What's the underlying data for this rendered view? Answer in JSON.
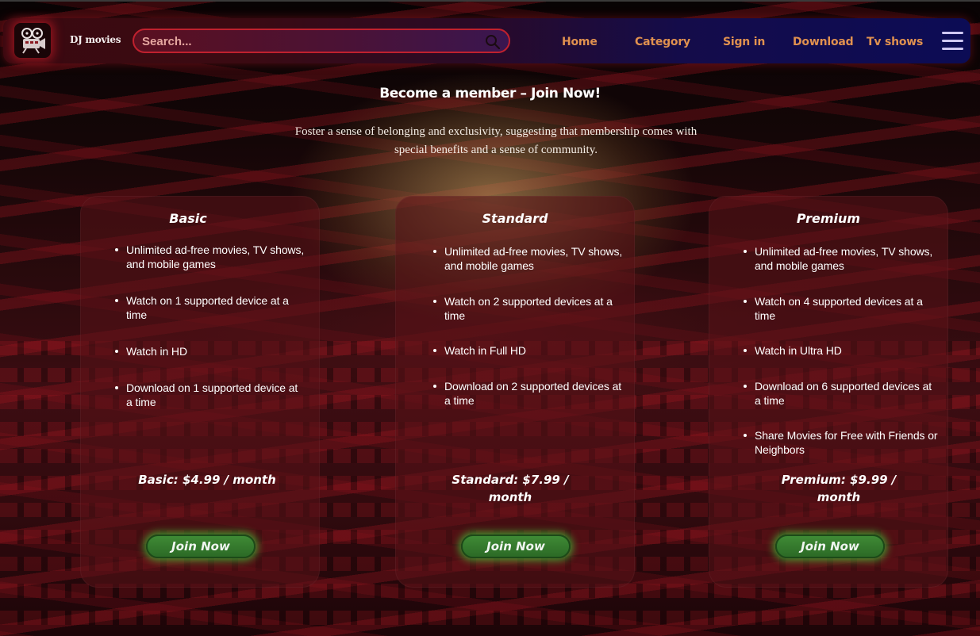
{
  "brand": {
    "name": "DJ movies",
    "logo_icon": "film-camera-icon"
  },
  "search": {
    "placeholder": "Search...",
    "icon": "search-icon"
  },
  "nav": {
    "links": [
      {
        "label": "Home"
      },
      {
        "label": "Category"
      },
      {
        "label": "Sign in"
      },
      {
        "label": "Download"
      },
      {
        "label": "Tv shows"
      }
    ],
    "menu_icon": "hamburger-menu-icon"
  },
  "hero": {
    "title": "Become a member – Join Now!",
    "subtitle": "Foster a sense of belonging and exclusivity, suggesting that membership comes with special benefits and a sense of community."
  },
  "plans": [
    {
      "name": "Basic",
      "features": [
        "Unlimited ad-free movies, TV shows, and mobile games",
        "Watch on 1 supported device at a time",
        "Watch in HD",
        "Download on 1 supported device at a time"
      ],
      "price": "Basic: $4.99 / month",
      "button": "Join Now"
    },
    {
      "name": "Standard",
      "features": [
        " Unlimited ad-free movies, TV shows, and mobile games",
        "Watch on 2 supported devices at a time",
        "Watch in Full HD",
        "Download on 2 supported devices at a time"
      ],
      "price": "Standard: $7.99 / month",
      "button": "Join Now"
    },
    {
      "name": "Premium",
      "features": [
        " Unlimited ad-free movies, TV shows, and mobile games",
        "Watch on 4 supported devices at a time",
        "Watch in Ultra HD",
        "Download on 6 supported devices at a time",
        "Share Movies for Free with Friends or Neighbors"
      ],
      "price": "Premium: $9.99 / month",
      "button": "Join Now"
    }
  ],
  "colors": {
    "nav_link": "#e0914f",
    "button_green": "#2c6a26",
    "search_border": "#c0212e"
  }
}
